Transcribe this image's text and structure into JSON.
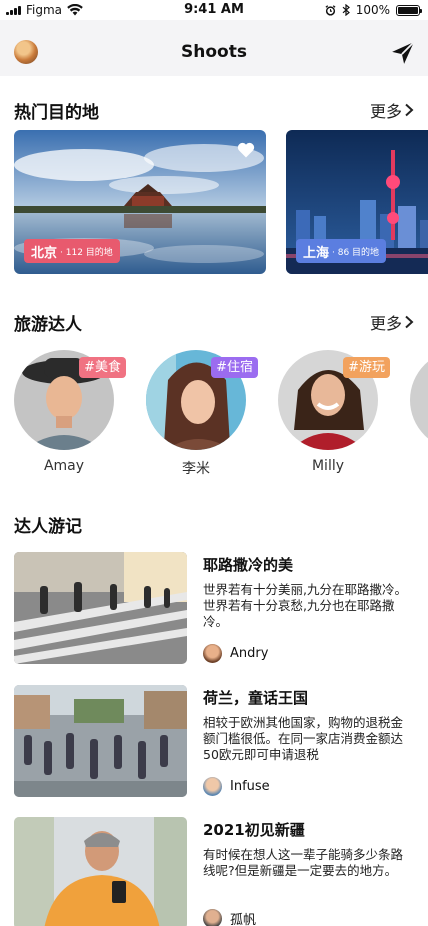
{
  "status_bar": {
    "carrier": "Figma",
    "time": "9:41 AM",
    "battery": "100%"
  },
  "nav": {
    "title": "Shoots",
    "avatar_icon": "user-avatar",
    "action_icon": "paper-plane-icon"
  },
  "destinations_section": {
    "title": "热门目的地",
    "more_label": "更多",
    "items": [
      {
        "city": "北京",
        "count": "· 112 目的地",
        "favorited": true,
        "label_color": "#e85a6e"
      },
      {
        "city": "上海",
        "count": "· 86 目的地",
        "favorited": false,
        "label_color": "#5b7ee0"
      }
    ]
  },
  "experts_section": {
    "title": "旅游达人",
    "more_label": "更多",
    "items": [
      {
        "name": "Amay",
        "tag": "#美食",
        "tag_color": "#f07282"
      },
      {
        "name": "李米",
        "tag": "#住宿",
        "tag_color": "#9b6cf0"
      },
      {
        "name": "Milly",
        "tag": "#游玩",
        "tag_color": "#f2a25e"
      }
    ]
  },
  "logs_section": {
    "title": "达人游记",
    "items": [
      {
        "title": "耶路撒冷的美",
        "desc": "世界若有十分美丽,九分在耶路撒冷。世界若有十分哀愁,九分也在耶路撒冷。",
        "author": "Andry"
      },
      {
        "title": "荷兰，童话王国",
        "desc": "相较于欧洲其他国家，购物的退税金额门槛很低。在同一家店消费金额达50欧元即可申请退税",
        "author": "Infuse"
      },
      {
        "title": "2021初见新疆",
        "desc": "有时候在想人这一辈子能骑多少条路线呢?但是新疆是一定要去的地方。",
        "author": "孤帆"
      }
    ]
  }
}
